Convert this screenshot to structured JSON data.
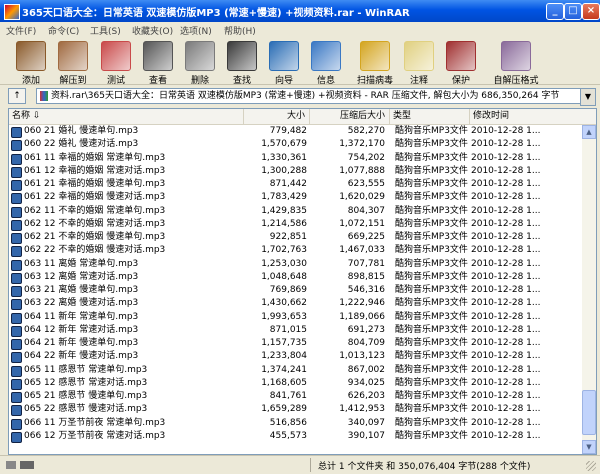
{
  "window": {
    "title": "365天口语大全：日常英语 双速模仿版MP3 (常速+慢速) +视频资料.rar - WinRAR",
    "controls": {
      "minimize": "_",
      "maximize": "□",
      "close": "×"
    }
  },
  "menu": [
    "文件(F)",
    "命令(C)",
    "工具(S)",
    "收藏夹(O)",
    "选项(N)",
    "帮助(H)"
  ],
  "toolbar": [
    {
      "label": "添加",
      "icon": "add-icon",
      "color": "#8a5a2a"
    },
    {
      "label": "解压到",
      "icon": "extract-to-icon",
      "color": "#a06a40"
    },
    {
      "label": "测试",
      "icon": "test-icon",
      "color": "#c94a4a"
    },
    {
      "label": "查看",
      "icon": "view-icon",
      "color": "#555555"
    },
    {
      "label": "删除",
      "icon": "delete-icon",
      "color": "#7a7a7a"
    },
    {
      "label": "查找",
      "icon": "find-icon",
      "color": "#3a3a3a"
    },
    {
      "label": "向导",
      "icon": "wizard-icon",
      "color": "#2a6db5"
    },
    {
      "label": "信息",
      "icon": "info-icon",
      "color": "#3a78c4"
    },
    {
      "label": "扫描病毒",
      "icon": "virus-scan-icon",
      "color": "#d4a520"
    },
    {
      "label": "注释",
      "icon": "comment-icon",
      "color": "#e0d080"
    },
    {
      "label": "保护",
      "icon": "protect-icon",
      "color": "#a03030"
    },
    {
      "label": "自解压格式",
      "icon": "sfx-icon",
      "color": "#8a6a9a"
    }
  ],
  "address": {
    "up_icon": "↑",
    "path": "资料.rar\\365天口语大全：日常英语 双速模仿版MP3 (常速+慢速) +视频资料 - RAR 压缩文件, 解包大小为 686,350,264 字节",
    "dropdown": "▼"
  },
  "columns": {
    "name": "名称",
    "size": "大小",
    "packed": "压缩后大小",
    "type": "类型",
    "modified": "修改时间",
    "sort_arrow": "⇩"
  },
  "files": [
    {
      "name": "060 21 婚礼 慢速单句.mp3",
      "size": "779,482",
      "packed": "582,270",
      "type": "酷狗音乐MP3文件",
      "modified": "2010-12-28 1..."
    },
    {
      "name": "060 22 婚礼 慢速对话.mp3",
      "size": "1,570,679",
      "packed": "1,372,170",
      "type": "酷狗音乐MP3文件",
      "modified": "2010-12-28 1..."
    },
    {
      "name": "061 11 幸福的婚姻 常速单句.mp3",
      "size": "1,330,361",
      "packed": "754,202",
      "type": "酷狗音乐MP3文件",
      "modified": "2010-12-28 1..."
    },
    {
      "name": "061 12 幸福的婚姻 常速对话.mp3",
      "size": "1,300,288",
      "packed": "1,077,888",
      "type": "酷狗音乐MP3文件",
      "modified": "2010-12-28 1..."
    },
    {
      "name": "061 21 幸福的婚姻 慢速单句.mp3",
      "size": "871,442",
      "packed": "623,555",
      "type": "酷狗音乐MP3文件",
      "modified": "2010-12-28 1..."
    },
    {
      "name": "061 22 幸福的婚姻 慢速对话.mp3",
      "size": "1,783,429",
      "packed": "1,620,029",
      "type": "酷狗音乐MP3文件",
      "modified": "2010-12-28 1..."
    },
    {
      "name": "062 11 不幸的婚姻 常速单句.mp3",
      "size": "1,429,835",
      "packed": "804,307",
      "type": "酷狗音乐MP3文件",
      "modified": "2010-12-28 1..."
    },
    {
      "name": "062 12 不幸的婚姻 常速对话.mp3",
      "size": "1,214,586",
      "packed": "1,072,151",
      "type": "酷狗音乐MP3文件",
      "modified": "2010-12-28 1..."
    },
    {
      "name": "062 21 不幸的婚姻 慢速单句.mp3",
      "size": "922,851",
      "packed": "669,225",
      "type": "酷狗音乐MP3文件",
      "modified": "2010-12-28 1..."
    },
    {
      "name": "062 22 不幸的婚姻 慢速对话.mp3",
      "size": "1,702,763",
      "packed": "1,467,033",
      "type": "酷狗音乐MP3文件",
      "modified": "2010-12-28 1..."
    },
    {
      "name": "063 11 离婚 常速单句.mp3",
      "size": "1,253,030",
      "packed": "707,781",
      "type": "酷狗音乐MP3文件",
      "modified": "2010-12-28 1..."
    },
    {
      "name": "063 12 离婚 常速对话.mp3",
      "size": "1,048,648",
      "packed": "898,815",
      "type": "酷狗音乐MP3文件",
      "modified": "2010-12-28 1..."
    },
    {
      "name": "063 21 离婚 慢速单句.mp3",
      "size": "769,869",
      "packed": "546,316",
      "type": "酷狗音乐MP3文件",
      "modified": "2010-12-28 1..."
    },
    {
      "name": "063 22 离婚 慢速对话.mp3",
      "size": "1,430,662",
      "packed": "1,222,946",
      "type": "酷狗音乐MP3文件",
      "modified": "2010-12-28 1..."
    },
    {
      "name": "064 11 新年 常速单句.mp3",
      "size": "1,993,653",
      "packed": "1,189,066",
      "type": "酷狗音乐MP3文件",
      "modified": "2010-12-28 1..."
    },
    {
      "name": "064 12 新年 常速对话.mp3",
      "size": "871,015",
      "packed": "691,273",
      "type": "酷狗音乐MP3文件",
      "modified": "2010-12-28 1..."
    },
    {
      "name": "064 21 新年 慢速单句.mp3",
      "size": "1,157,735",
      "packed": "804,709",
      "type": "酷狗音乐MP3文件",
      "modified": "2010-12-28 1..."
    },
    {
      "name": "064 22 新年 慢速对话.mp3",
      "size": "1,233,804",
      "packed": "1,013,123",
      "type": "酷狗音乐MP3文件",
      "modified": "2010-12-28 1..."
    },
    {
      "name": "065 11 感恩节 常速单句.mp3",
      "size": "1,374,241",
      "packed": "867,002",
      "type": "酷狗音乐MP3文件",
      "modified": "2010-12-28 1..."
    },
    {
      "name": "065 12 感恩节 常速对话.mp3",
      "size": "1,168,605",
      "packed": "934,025",
      "type": "酷狗音乐MP3文件",
      "modified": "2010-12-28 1..."
    },
    {
      "name": "065 21 感恩节 慢速单句.mp3",
      "size": "841,761",
      "packed": "626,203",
      "type": "酷狗音乐MP3文件",
      "modified": "2010-12-28 1..."
    },
    {
      "name": "065 22 感恩节 慢速对话.mp3",
      "size": "1,659,289",
      "packed": "1,412,953",
      "type": "酷狗音乐MP3文件",
      "modified": "2010-12-28 1..."
    },
    {
      "name": "066 11 万圣节前夜 常速单句.mp3",
      "size": "516,856",
      "packed": "340,097",
      "type": "酷狗音乐MP3文件",
      "modified": "2010-12-28 1..."
    },
    {
      "name": "066 12 万圣节前夜 常速对话.mp3",
      "size": "455,573",
      "packed": "390,107",
      "type": "酷狗音乐MP3文件",
      "modified": "2010-12-28 1..."
    }
  ],
  "status": {
    "text": "总计 1 个文件夹 和 350,076,404 字节(288 个文件)"
  }
}
